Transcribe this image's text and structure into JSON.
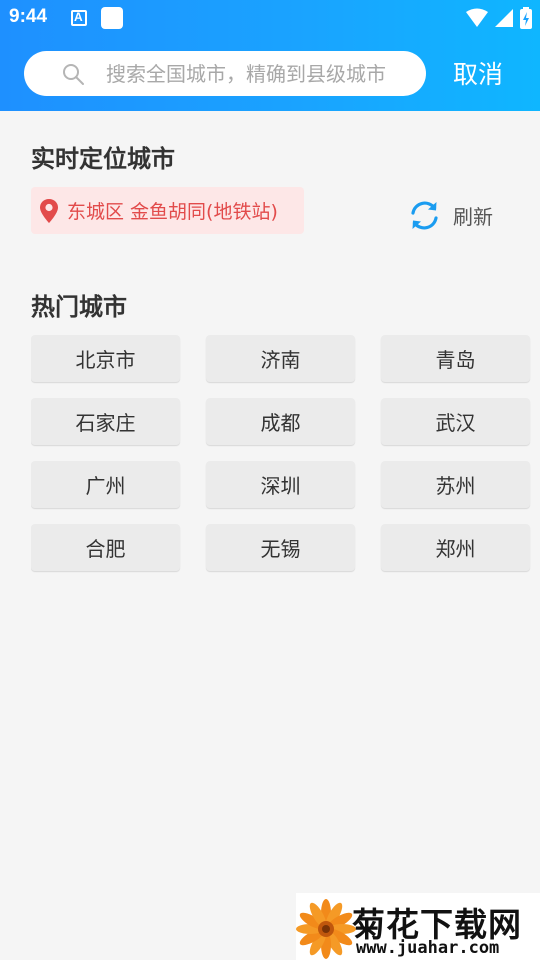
{
  "status_bar": {
    "time": "9:44",
    "notification_icon": "a-icon",
    "icons": [
      "app-square-icon",
      "wifi-icon",
      "signal-icon",
      "battery-icon"
    ]
  },
  "search": {
    "value": "",
    "placeholder": "搜索全国城市，精确到县级城市",
    "cancel_label": "取消"
  },
  "location": {
    "title": "实时定位城市",
    "current": "东城区 金鱼胡同(地铁站)",
    "refresh_label": "刷新"
  },
  "hot": {
    "title": "热门城市",
    "cities": [
      "北京市",
      "济南",
      "青岛",
      "石家庄",
      "成都",
      "武汉",
      "广州",
      "深圳",
      "苏州",
      "合肥",
      "无锡",
      "郑州"
    ]
  },
  "watermark": {
    "title": "菊花下载网",
    "url": "www.juahar.com"
  },
  "colors": {
    "header_gradient_start": "#1e90ff",
    "header_gradient_end": "#0fb6ff",
    "location_text": "#e24b4b",
    "location_bg": "#fde7e7",
    "refresh_icon": "#1a9cf0",
    "city_button_bg": "#ebebeb"
  }
}
